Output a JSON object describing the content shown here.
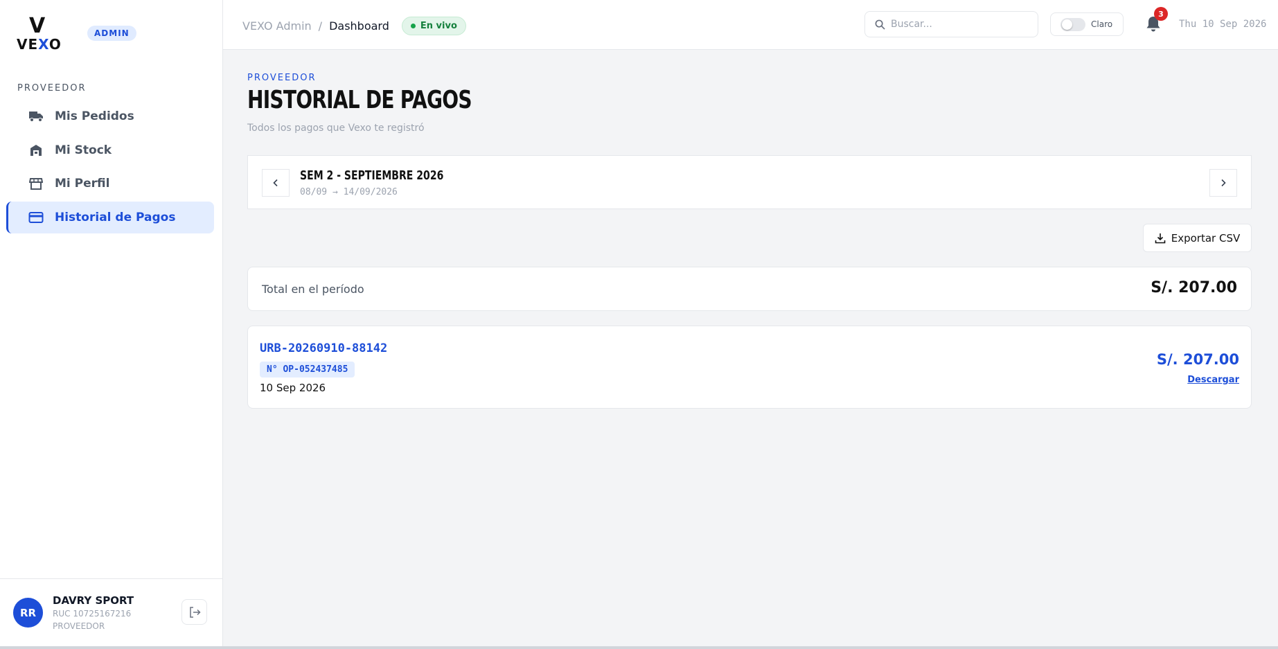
{
  "brand": {
    "logo_top": "V",
    "logo_word_a": "VE",
    "logo_word_x": "X",
    "logo_word_b": "O",
    "badge": "ADMIN"
  },
  "sidebar": {
    "section": "PROVEEDOR",
    "items": [
      {
        "label": "Mis Pedidos",
        "icon": "truck-icon"
      },
      {
        "label": "Mi Stock",
        "icon": "warehouse-icon"
      },
      {
        "label": "Mi Perfil",
        "icon": "store-icon"
      },
      {
        "label": "Historial de Pagos",
        "icon": "credit-card-icon",
        "active": true
      }
    ]
  },
  "user": {
    "initials": "RR",
    "name": "DAVRY SPORT",
    "ruc": "RUC 10725167216",
    "role": "PROVEEDOR"
  },
  "header": {
    "crumb_root": "VEXO Admin",
    "crumb_sep": "/",
    "crumb_current": "Dashboard",
    "live_label": "En vivo",
    "search_placeholder": "Buscar...",
    "theme_label": "Claro",
    "notifications": "3",
    "date": "Thu 10 Sep 2026"
  },
  "page": {
    "eyebrow": "PROVEEDOR",
    "title": "HISTORIAL DE PAGOS",
    "subtitle": "Todos los pagos que Vexo te registró"
  },
  "week": {
    "title": "SEM 2 - SEPTIEMBRE 2026",
    "range": "08/09 → 14/09/2026"
  },
  "export_label": "Exportar CSV",
  "total": {
    "label": "Total en el período",
    "value": "S/. 207.00"
  },
  "payments": [
    {
      "code": "URB-20260910-88142",
      "op": "N° OP-052437485",
      "date": "10 Sep 2026",
      "amount": "S/. 207.00",
      "download": "Descargar"
    }
  ],
  "colors": {
    "accent": "#1d4ed8",
    "live": "#16a34a",
    "badge_alert": "#dc2626"
  }
}
